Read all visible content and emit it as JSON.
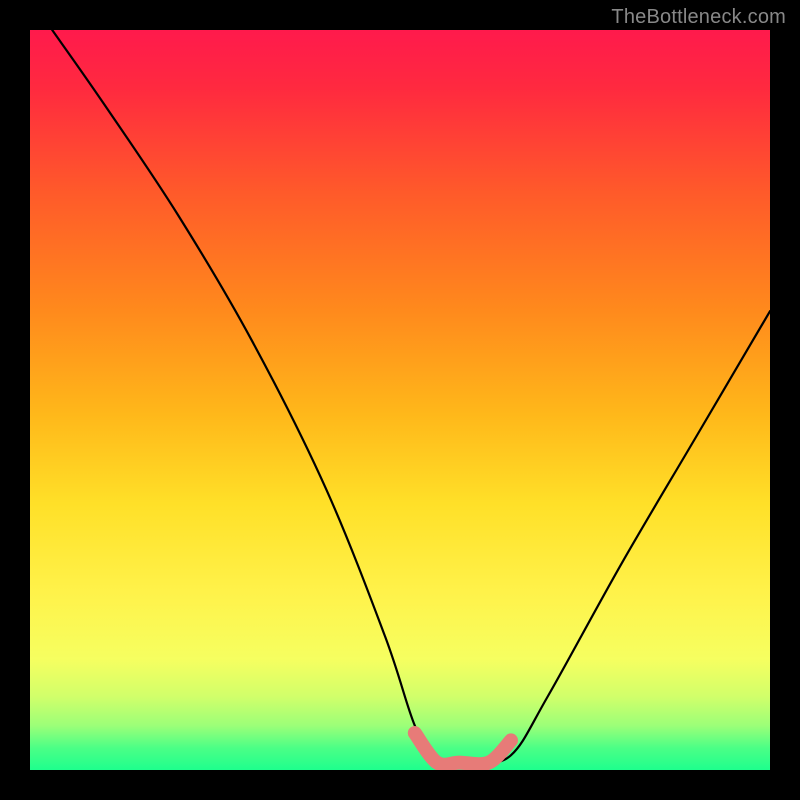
{
  "watermark": "TheBottleneck.com",
  "chart_data": {
    "type": "line",
    "title": "",
    "xlabel": "",
    "ylabel": "",
    "xlim": [
      0,
      100
    ],
    "ylim": [
      0,
      100
    ],
    "series": [
      {
        "name": "main-curve",
        "color": "#000000",
        "x": [
          3,
          10,
          20,
          30,
          40,
          48,
          52,
          55,
          60,
          65,
          70,
          80,
          90,
          100
        ],
        "y": [
          100,
          90,
          75,
          58,
          38,
          18,
          6,
          1,
          1,
          2,
          10,
          28,
          45,
          62
        ]
      },
      {
        "name": "trough-highlight",
        "color": "#e77b78",
        "x": [
          52,
          55,
          58,
          62,
          65
        ],
        "y": [
          5,
          1,
          1,
          1,
          4
        ]
      }
    ],
    "gradient_stops": [
      {
        "pct": 0,
        "color": "#ff1a4c"
      },
      {
        "pct": 8,
        "color": "#ff2a3f"
      },
      {
        "pct": 22,
        "color": "#ff5a2a"
      },
      {
        "pct": 38,
        "color": "#ff8a1c"
      },
      {
        "pct": 52,
        "color": "#ffb81a"
      },
      {
        "pct": 64,
        "color": "#ffe028"
      },
      {
        "pct": 76,
        "color": "#fff24a"
      },
      {
        "pct": 85,
        "color": "#f6ff60"
      },
      {
        "pct": 90,
        "color": "#d2ff6a"
      },
      {
        "pct": 94,
        "color": "#9cff78"
      },
      {
        "pct": 97,
        "color": "#4cff86"
      },
      {
        "pct": 100,
        "color": "#1eff8d"
      }
    ]
  }
}
